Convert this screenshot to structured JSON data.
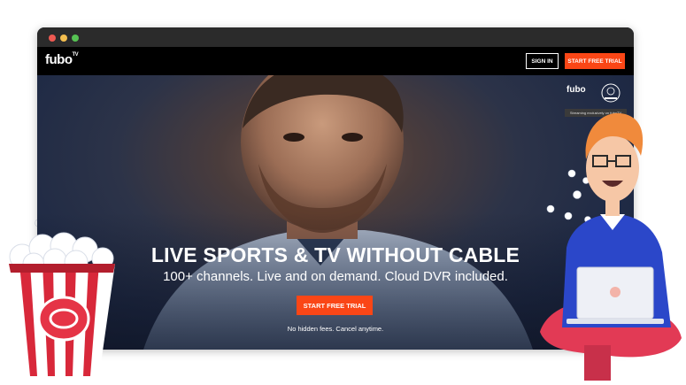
{
  "nav": {
    "logo": "fubo",
    "logo_sup": "TV",
    "sign_in": "SIGN IN",
    "start_trial": "START FREE TRIAL"
  },
  "badge": {
    "logo": "fubo",
    "caption": "Streaming exclusively on fuboTV"
  },
  "hero": {
    "headline": "LIVE SPORTS & TV WITHOUT CABLE",
    "subline": "100+ channels. Live and on demand. Cloud DVR included.",
    "cta": "START FREE TRIAL",
    "fineprint": "No hidden fees. Cancel anytime."
  },
  "colors": {
    "accent": "#fa4616",
    "window_bar": "#2b2b2b",
    "nav_bg": "#000000"
  },
  "icons": [
    "window-close-dot",
    "window-minimize-dot",
    "window-maximize-dot",
    "popcorn-bucket-illustration",
    "person-with-laptop-illustration"
  ]
}
